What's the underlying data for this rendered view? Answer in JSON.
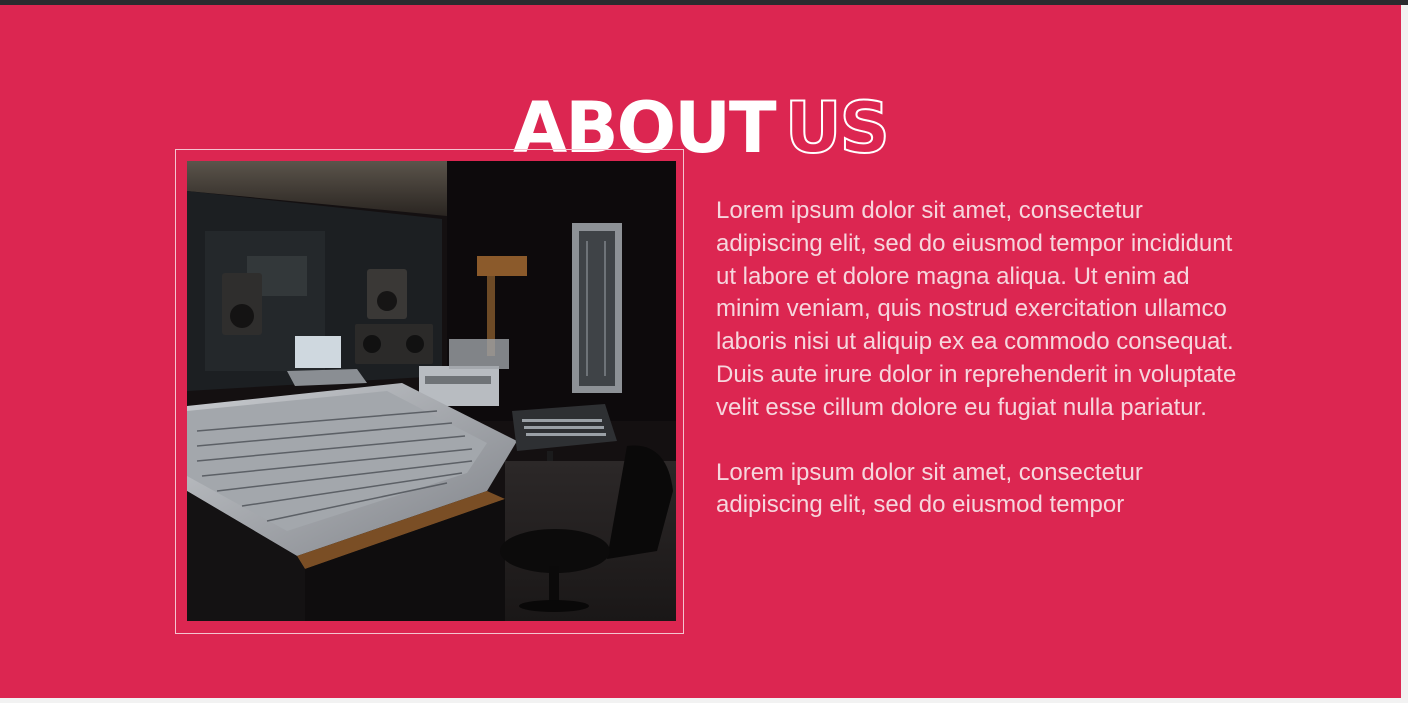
{
  "about": {
    "title_solid": "ABOUT",
    "title_outline": "US",
    "image_alt": "Recording studio control room with mixing console",
    "paragraph_1": "Lorem ipsum dolor sit amet, consectetur adipiscing elit, sed do eiusmod tempor incididunt ut labore et dolore magna aliqua. Ut enim ad minim veniam, quis nostrud exercitation ullamco laboris nisi ut aliquip ex ea commodo consequat. Duis aute irure dolor in reprehenderit in voluptate velit esse cillum dolore eu fugiat nulla pariatur.",
    "paragraph_2": "Lorem ipsum dolor sit amet, consectetur adipiscing elit, sed do eiusmod tempor"
  },
  "colors": {
    "section_bg": "#dc2651",
    "topbar": "#2b2b2f",
    "text": "#f6d6dd",
    "title": "#ffffff"
  }
}
